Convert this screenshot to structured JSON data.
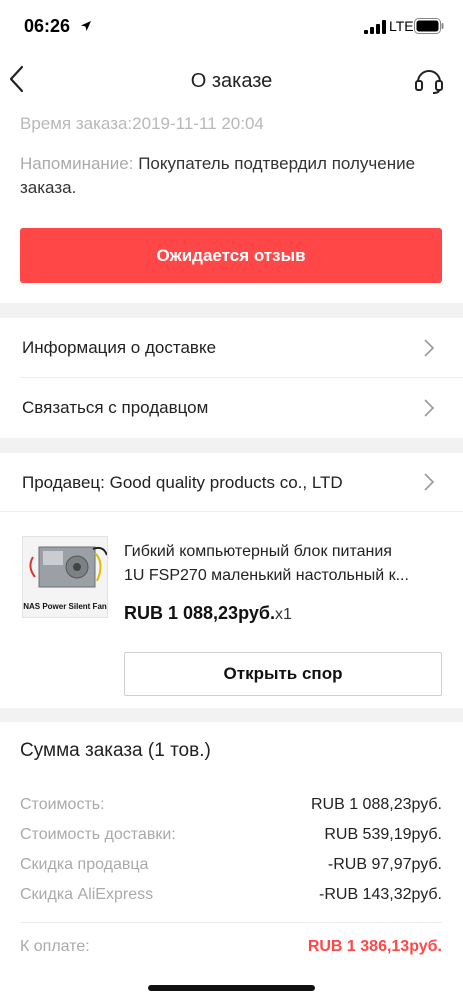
{
  "status_bar": {
    "time": "06:26",
    "network": "LTE"
  },
  "nav": {
    "title": "О заказе"
  },
  "order": {
    "time_text": "Время заказа:2019-11-11 20:04",
    "reminder_label": "Напоминание:",
    "reminder_text": " Покупатель подтвердил получение заказа.",
    "review_button": "Ожидается отзыв"
  },
  "menu": {
    "delivery_info": "Информация о доставке",
    "contact_seller": "Связаться с продавцом"
  },
  "seller": {
    "label": "Продавец: Good quality products co., LTD"
  },
  "product": {
    "image_caption": "NAS Power Silent Fan",
    "title_line1": "Гибкий компьютерный блок питания",
    "title_line2": "1U FSP270 маленький настольный к...",
    "price": "RUB 1 088,23руб.",
    "quantity": "x1",
    "dispute_button": "Открыть спор"
  },
  "summary": {
    "title": "Сумма заказа (1 тов.)",
    "lines": [
      {
        "label": "Стоимость:",
        "value": "RUB 1 088,23руб."
      },
      {
        "label": "Стоимость доставки:",
        "value": "RUB 539,19руб."
      },
      {
        "label": "Скидка продавца",
        "value": "-RUB 97,97руб."
      },
      {
        "label": "Скидка AliExpress",
        "value": "-RUB 143,32руб."
      }
    ],
    "total_label": "К оплате:",
    "total_value": "RUB 1 386,13руб."
  },
  "colors": {
    "accent": "#ff4747",
    "muted_text": "#aaaaaa",
    "section_gap": "#f2f2f2"
  },
  "icons": [
    "location-arrow-icon",
    "signal-icon",
    "battery-icon",
    "back-arrow-icon",
    "headset-support-icon",
    "chevron-right-icon"
  ]
}
